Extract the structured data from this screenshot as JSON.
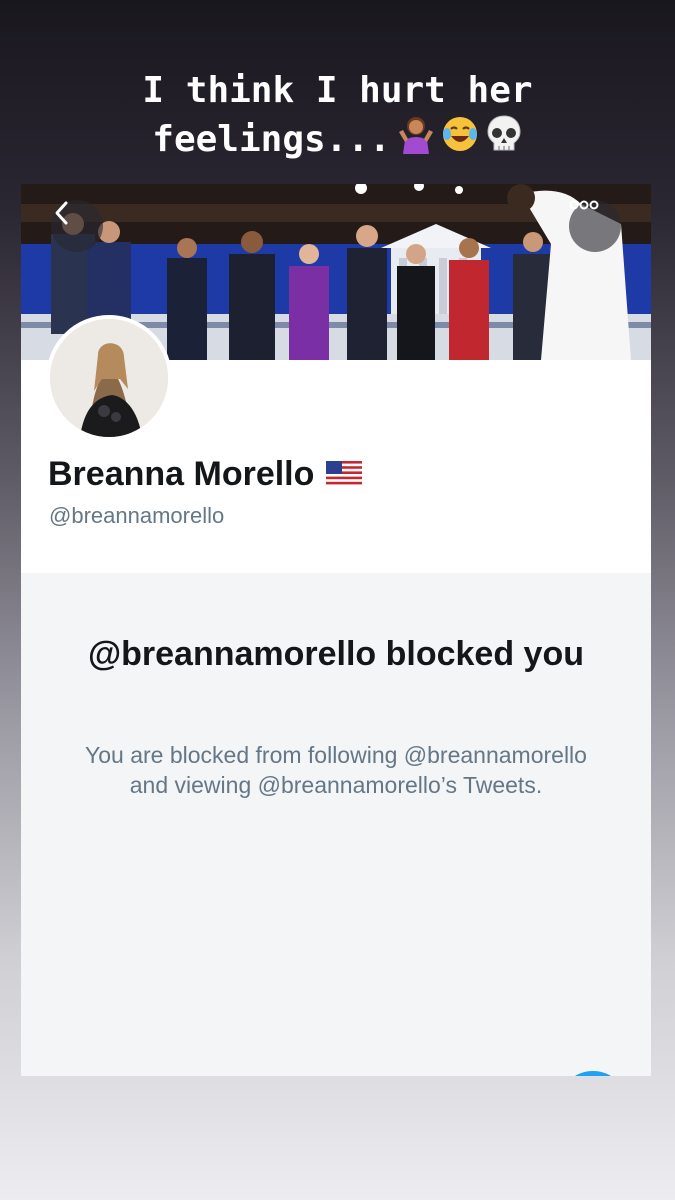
{
  "story": {
    "caption_line1": "I think I hurt her",
    "caption_line2": "feelings...",
    "caption_emojis": [
      "person-shrugging-emoji",
      "face-with-tears-of-joy-emoji",
      "skull-emoji"
    ]
  },
  "profile": {
    "display_name": "Breanna Morello",
    "flag_icon": "us-flag-icon",
    "handle": "@breannamorello"
  },
  "blocked": {
    "title": "@breannamorello blocked you",
    "message": "You are blocked from following @breannamorello and viewing @breannamorello’s Tweets."
  },
  "colors": {
    "accent": "#1da1f2",
    "secondary_text": "#657786",
    "primary_text": "#14171a"
  }
}
